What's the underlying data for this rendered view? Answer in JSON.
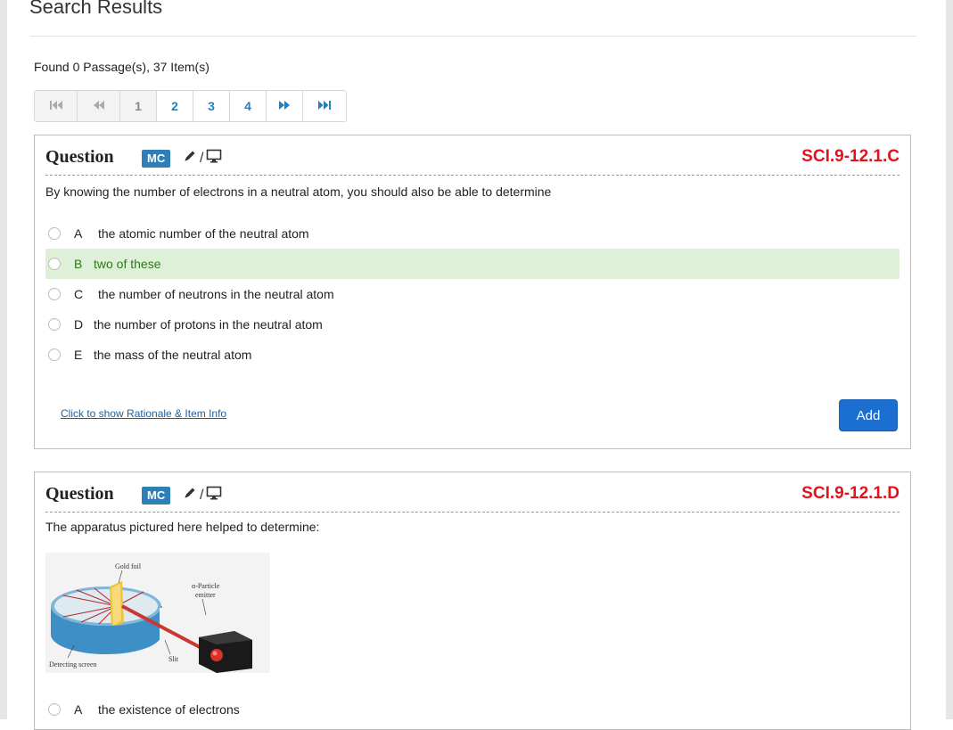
{
  "page": {
    "title": "Search Results",
    "found_text": "Found 0 Passage(s), 37 Item(s)"
  },
  "pager": {
    "items": [
      {
        "label": "⏮",
        "icon": "first-page-icon",
        "state": "disabled"
      },
      {
        "label": "⏪",
        "icon": "prev-page-icon",
        "state": "disabled"
      },
      {
        "label": "1",
        "state": "active"
      },
      {
        "label": "2",
        "state": "link"
      },
      {
        "label": "3",
        "state": "link"
      },
      {
        "label": "4",
        "state": "link"
      },
      {
        "label": "⏩",
        "icon": "next-page-icon",
        "state": "link"
      },
      {
        "label": "⏭",
        "icon": "last-page-icon",
        "state": "link"
      }
    ]
  },
  "questions": [
    {
      "title": "Question",
      "badge": "MC",
      "mode_separator": "/",
      "standard": "SCI.9-12.1.C",
      "stem": "By knowing the number of electrons in a neutral atom, you should also be able to determine",
      "options": [
        {
          "letter": "A",
          "text": "the atomic number of the neutral atom",
          "correct": false
        },
        {
          "letter": "B",
          "text": "two of these",
          "correct": true
        },
        {
          "letter": "C",
          "text": "the number of neutrons in the neutral atom",
          "correct": false
        },
        {
          "letter": "D",
          "text": "the number of protons in the neutral atom",
          "correct": false
        },
        {
          "letter": "E",
          "text": "the mass of the neutral atom",
          "correct": false
        }
      ],
      "rationale_link": "Click to show Rationale & Item Info",
      "add_label": "Add"
    },
    {
      "title": "Question",
      "badge": "MC",
      "mode_separator": "/",
      "standard": "SCI.9-12.1.D",
      "stem": "The apparatus pictured here helped to determine:",
      "figure_labels": {
        "gold": "Gold foil",
        "particle": "α-Particle",
        "emitter": "emitter",
        "screen": "Detecting screen",
        "slit": "Slit"
      },
      "options": [
        {
          "letter": "A",
          "text": "the existence of electrons",
          "correct": false
        }
      ]
    }
  ],
  "colors": {
    "accent": "#1a6fd1",
    "badge": "#2f7fb6",
    "standard": "#e0141e",
    "correct_bg": "#dff0d8",
    "correct_text": "#2b7a17"
  }
}
